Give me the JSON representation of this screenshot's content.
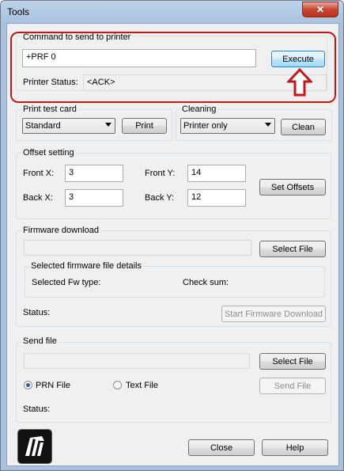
{
  "window": {
    "title": "Tools",
    "close_glyph": "✕"
  },
  "command": {
    "group_label": "Command to send to printer",
    "input_value": "+PRF 0",
    "execute_label": "Execute",
    "status_label": "Printer Status:",
    "status_value": "<ACK>"
  },
  "print_test": {
    "group_label": "Print test card",
    "selected": "Standard",
    "print_label": "Print"
  },
  "cleaning": {
    "group_label": "Cleaning",
    "selected": "Printer only",
    "clean_label": "Clean"
  },
  "offset": {
    "group_label": "Offset setting",
    "front_x_label": "Front X:",
    "front_x_value": "3",
    "front_y_label": "Front Y:",
    "front_y_value": "14",
    "back_x_label": "Back X:",
    "back_x_value": "3",
    "back_y_label": "Back Y:",
    "back_y_value": "12",
    "set_label": "Set Offsets"
  },
  "firmware": {
    "group_label": "Firmware download",
    "select_file_label": "Select File",
    "details_label": "Selected firmware file details",
    "fw_type_label": "Selected Fw type:",
    "checksum_label": "Check sum:",
    "status_label": "Status:",
    "start_label": "Start Firmware Download"
  },
  "send_file": {
    "group_label": "Send file",
    "select_file_label": "Select File",
    "prn_label": "PRN File",
    "text_label": "Text File",
    "send_label": "Send File",
    "status_label": "Status:"
  },
  "footer": {
    "close_label": "Close",
    "help_label": "Help"
  },
  "colors": {
    "highlight": "#c4161c",
    "accent": "#3c7fb1"
  }
}
